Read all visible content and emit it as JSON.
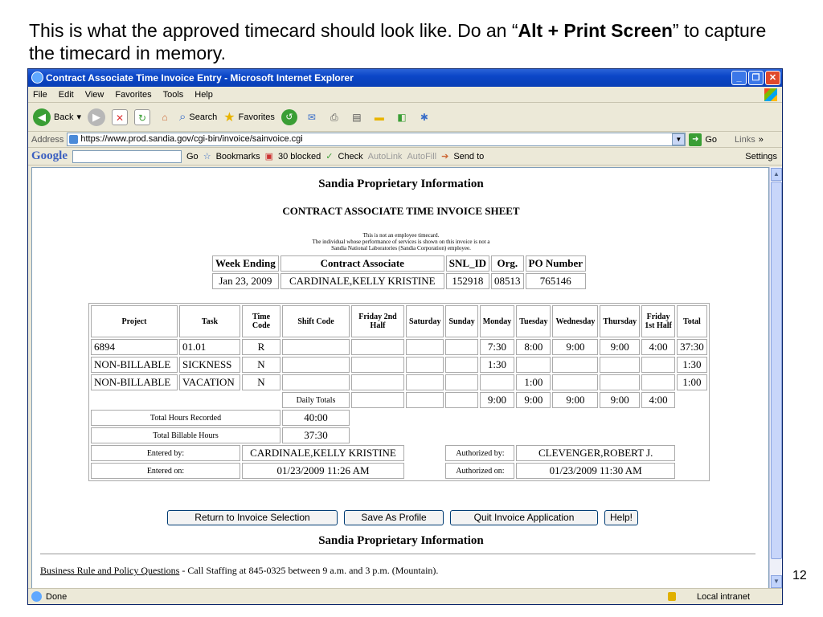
{
  "slide": {
    "title_pre": "This is what the approved timecard should look like. Do an “",
    "title_bold": "Alt + Print Screen",
    "title_post": "” to capture the timecard in memory.",
    "page_number": "12"
  },
  "window": {
    "title": "Contract Associate Time Invoice Entry - Microsoft Internet Explorer",
    "menu": [
      "File",
      "Edit",
      "View",
      "Favorites",
      "Tools",
      "Help"
    ],
    "toolbar": {
      "back": "Back",
      "search": "Search",
      "favorites": "Favorites"
    },
    "address_label": "Address",
    "address": "https://www.prod.sandia.gov/cgi-bin/invoice/sainvoice.cgi",
    "go": "Go",
    "links": "Links",
    "google": {
      "logo": "Google",
      "go": "Go",
      "bookmarks": "Bookmarks",
      "blocked": "30 blocked",
      "check": "Check",
      "autolink": "AutoLink",
      "autofill": "AutoFill",
      "sendto": "Send to",
      "settings": "Settings"
    },
    "status": "Done",
    "zone": "Local intranet"
  },
  "page": {
    "header": "Sandia Proprietary Information",
    "sheet_title": "CONTRACT ASSOCIATE TIME INVOICE SHEET",
    "disclaimer": [
      "This is not an employee timecard.",
      "The individual whose performance of services is shown on this invoice is not a",
      "Sandia National Laboratories (Sandia Corporation) employee."
    ],
    "week_headers": [
      "Week Ending",
      "Contract Associate",
      "SNL_ID",
      "Org.",
      "PO Number"
    ],
    "week_values": [
      "Jan 23, 2009",
      "CARDINALE,KELLY KRISTINE",
      "152918",
      "08513",
      "765146"
    ],
    "columns": [
      "Project",
      "Task",
      "Time Code",
      "Shift Code",
      "Friday 2nd Half",
      "Saturday",
      "Sunday",
      "Monday",
      "Tuesday",
      "Wednesday",
      "Thursday",
      "Friday 1st Half",
      "Total"
    ],
    "rows": [
      [
        "6894",
        "01.01",
        "R",
        "",
        "",
        "",
        "",
        "7:30",
        "8:00",
        "9:00",
        "9:00",
        "4:00",
        "37:30"
      ],
      [
        "NON-BILLABLE",
        "SICKNESS",
        "N",
        "",
        "",
        "",
        "",
        "1:30",
        "",
        "",
        "",
        "",
        "1:30"
      ],
      [
        "NON-BILLABLE",
        "VACATION",
        "N",
        "",
        "",
        "",
        "",
        "",
        "1:00",
        "",
        "",
        "",
        "1:00"
      ]
    ],
    "daily_totals_label": "Daily Totals",
    "daily_totals": [
      "",
      "",
      "",
      "9:00",
      "9:00",
      "9:00",
      "9:00",
      "4:00"
    ],
    "total_hours_label": "Total Hours Recorded",
    "total_hours": "40:00",
    "billable_hours_label": "Total Billable Hours",
    "billable_hours": "37:30",
    "entered_by_label": "Entered by:",
    "entered_by": "CARDINALE,KELLY KRISTINE",
    "authorized_by_label": "Authorized by:",
    "authorized_by": "CLEVENGER,ROBERT J.",
    "entered_on_label": "Entered on:",
    "entered_on": "01/23/2009 11:26 AM",
    "authorized_on_label": "Authorized on:",
    "authorized_on": "01/23/2009 11:30 AM",
    "buttons": {
      "return": "Return to Invoice Selection",
      "save": "Save As Profile",
      "quit": "Quit Invoice Application",
      "help": "Help!"
    },
    "footer_header": "Sandia Proprietary Information",
    "footer_link": "Business Rule and Policy Questions",
    "footer_text": " - Call Staffing at 845-0325 between 9 a.m. and 3 p.m. (Mountain)."
  }
}
